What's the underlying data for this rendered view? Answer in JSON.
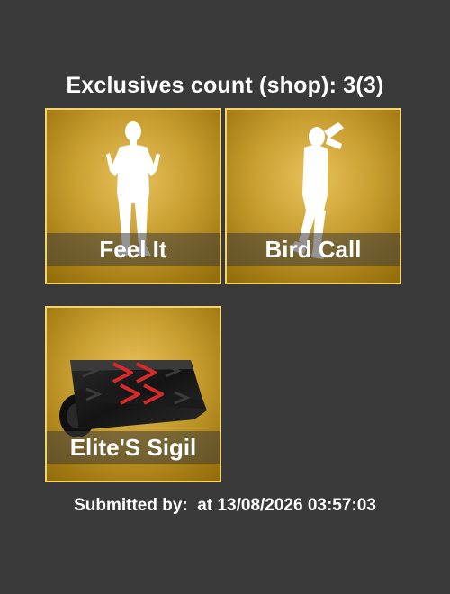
{
  "header": {
    "title": "Exclusives count (shop): 3(3)"
  },
  "items": [
    {
      "name": "Feel It",
      "icon": "dance-silhouette-icon"
    },
    {
      "name": "Bird Call",
      "icon": "dance-silhouette-icon"
    },
    {
      "name": "Elite'S Sigil",
      "icon": "wrap-icon"
    }
  ],
  "footer": {
    "submitted_label": "Submitted by:",
    "submitted_user": "",
    "at_label": "at",
    "timestamp": "13/08/2026 03:57:03",
    "text": "Submitted by:  at 13/08/2026 03:57:03"
  },
  "colors": {
    "background": "#3a3a3a",
    "tile_border": "#f3d36e",
    "tile_gold": "#c89e30"
  }
}
